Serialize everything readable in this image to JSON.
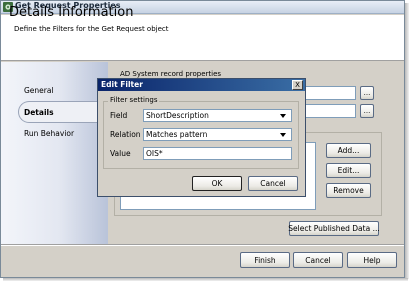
{
  "window": {
    "title": "Get Request Properties"
  },
  "header": {
    "title": "Details Information",
    "subtitle": "Define the Filters for the Get Request object"
  },
  "nav": {
    "items": [
      {
        "label": "General",
        "selected": false
      },
      {
        "label": "Details",
        "selected": true
      },
      {
        "label": "Run Behavior",
        "selected": false
      }
    ]
  },
  "content": {
    "section_label": "AD System record properties",
    "browse_label": "...",
    "filters_side_buttons": {
      "add": "Add...",
      "edit": "Edit...",
      "remove": "Remove"
    },
    "select_published_data": "Select Published Data ..."
  },
  "footer": {
    "finish": "Finish",
    "cancel": "Cancel",
    "help": "Help"
  },
  "dialog": {
    "title": "Edit Filter",
    "close_glyph": "X",
    "group_label": "Filter settings",
    "field_label": "Field",
    "field_value": "ShortDescription",
    "relation_label": "Relation",
    "relation_value": "Matches pattern",
    "value_label": "Value",
    "value_value": "OIS*",
    "ok": "OK",
    "cancel": "Cancel"
  },
  "colors": {
    "dialog_title": "#0a246a",
    "nav_gradient_end": "#b9c3d9"
  }
}
